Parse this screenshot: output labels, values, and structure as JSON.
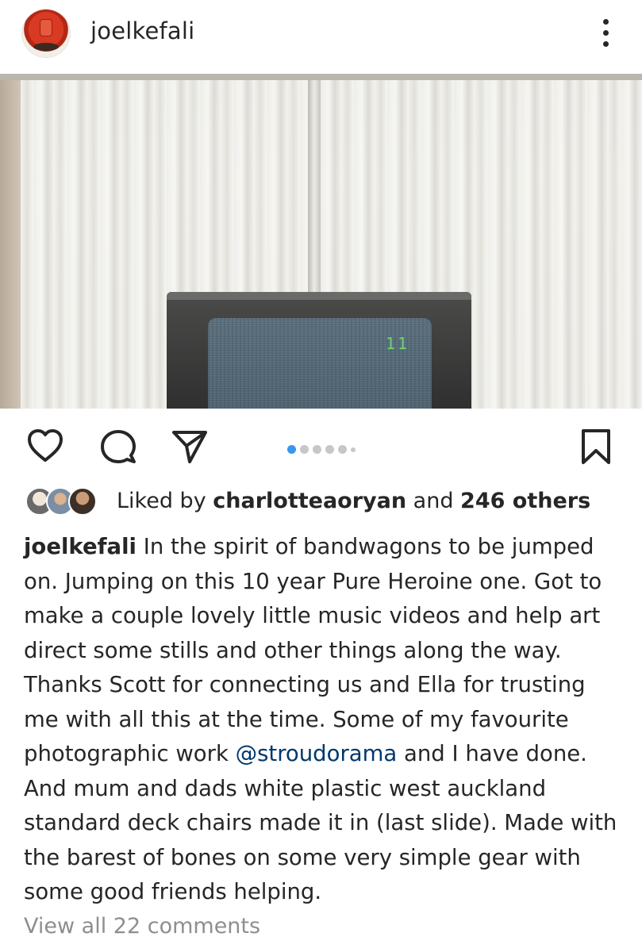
{
  "header": {
    "username": "joelkefali"
  },
  "post": {
    "tv_channel": "11",
    "carousel": {
      "count": 6,
      "active_index": 0
    }
  },
  "actions": {
    "icons": [
      "heart-icon",
      "comment-icon",
      "paper-plane-icon",
      "bookmark-icon"
    ]
  },
  "likes": {
    "prefix": "Liked by ",
    "user": "charlotteaoryan",
    "middle": " and ",
    "others": "246 others"
  },
  "caption": {
    "username": "joelkefali",
    "text_before_mention": " In the spirit of bandwagons to be jumped on. Jumping on this 10 year Pure Heroine one. Got to make a couple lovely little music videos and help art direct  some stills and other things along the way. Thanks Scott for connecting us and Ella for trusting me with all this at the time. Some of my favourite photographic work ",
    "mention": "@stroudorama",
    "text_after_mention": " and I have done. And mum and dads white plastic west auckland standard deck chairs made it in (last slide). Made with the barest of bones on some very simple gear with some good friends helping."
  },
  "comments": {
    "view_all": "View all 22 comments"
  },
  "colors": {
    "text": "#262626",
    "link": "#00376b",
    "muted": "#8e8e8e",
    "active_dot": "#3897f0"
  }
}
